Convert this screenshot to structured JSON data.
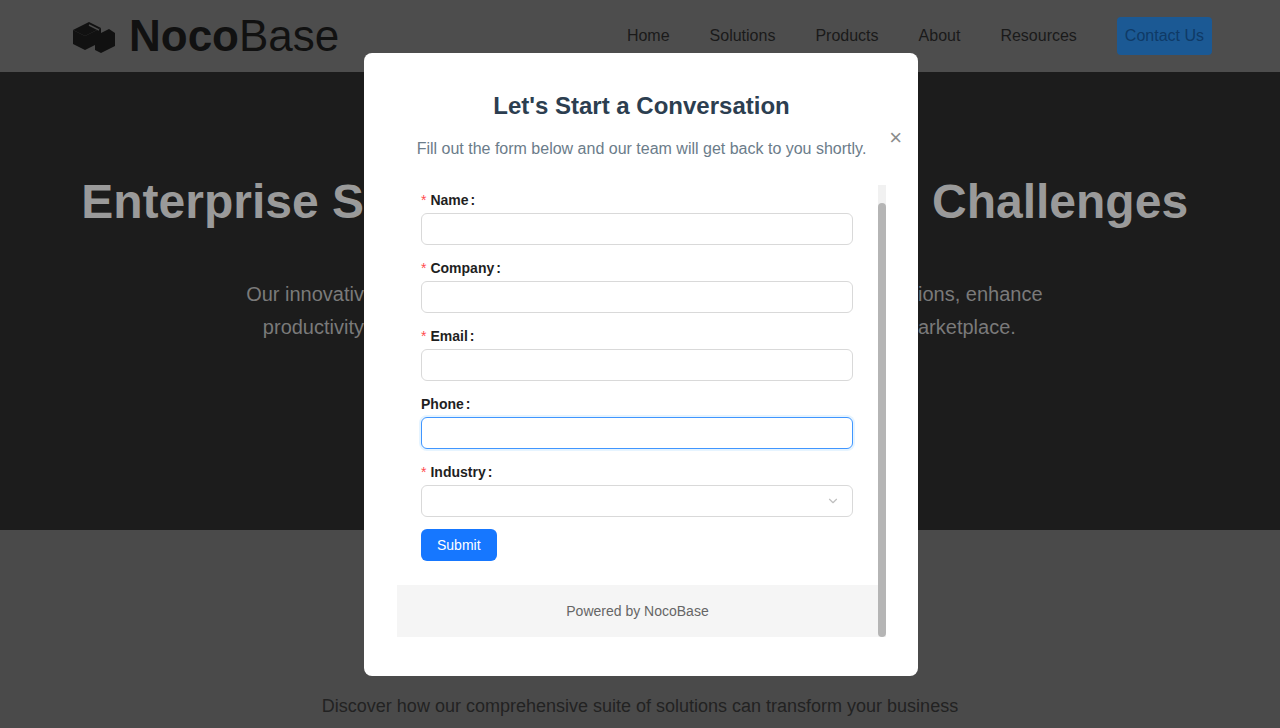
{
  "header": {
    "logo": {
      "bold": "Noco",
      "light": "Base"
    },
    "nav": [
      {
        "label": "Home"
      },
      {
        "label": "Solutions"
      },
      {
        "label": "Products"
      },
      {
        "label": "About"
      },
      {
        "label": "Resources"
      }
    ],
    "cta": "Contact Us"
  },
  "hero": {
    "title_left": "Enterprise S",
    "title_right": "Challenges",
    "lines": [
      {
        "left": "Our innovativ",
        "right": "ions, enhance"
      },
      {
        "left": "productivity",
        "right": "arketplace."
      }
    ]
  },
  "section": {
    "subtitle": "Discover how our comprehensive suite of solutions can transform your business"
  },
  "modal": {
    "title": "Let's Start a Conversation",
    "subtitle": "Fill out the form below and our team will get back to you shortly.",
    "close": "×",
    "required_mark": "*",
    "separator": ":",
    "fields": [
      {
        "label": "Name",
        "required": true,
        "focused": false,
        "kind": "input",
        "value": ""
      },
      {
        "label": "Company",
        "required": true,
        "focused": false,
        "kind": "input",
        "value": ""
      },
      {
        "label": "Email",
        "required": true,
        "focused": false,
        "kind": "input",
        "value": ""
      },
      {
        "label": "Phone",
        "required": false,
        "focused": true,
        "kind": "input",
        "value": ""
      },
      {
        "label": "Industry",
        "required": true,
        "focused": false,
        "kind": "select",
        "value": ""
      }
    ],
    "submit": "Submit",
    "footer": "Powered by NocoBase",
    "scrollbar": {
      "level": 0.96
    }
  }
}
